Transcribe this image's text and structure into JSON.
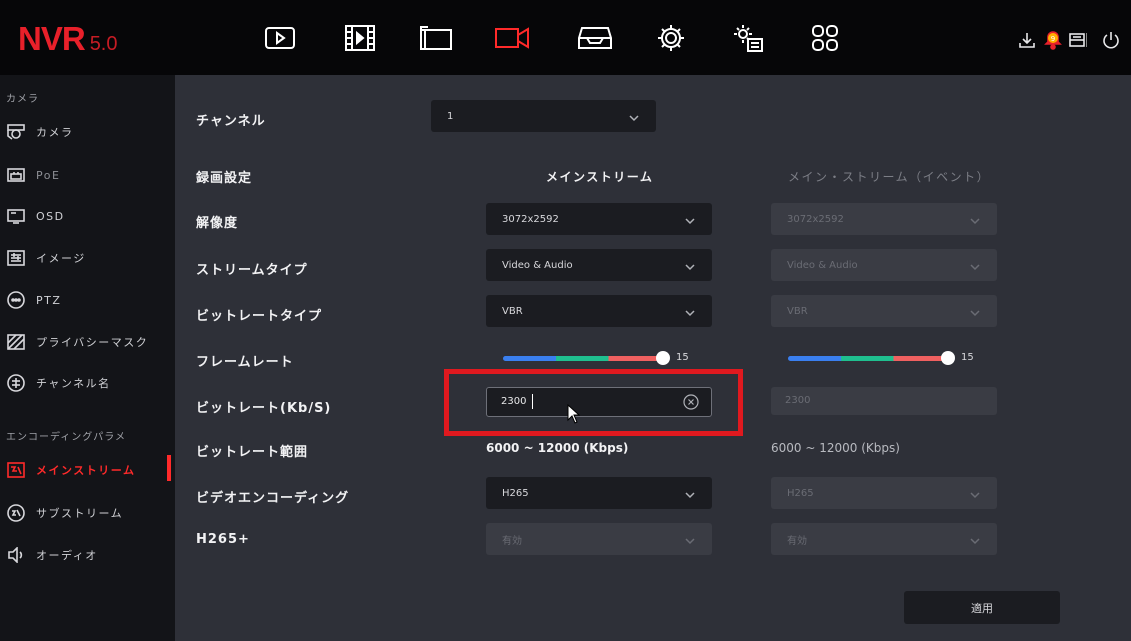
{
  "app": {
    "logo_main": "NVR",
    "logo_version": "5.0"
  },
  "topbar": {
    "nav_icons": [
      "live-view-icon",
      "playback-icon",
      "file-folder-icon",
      "camera-record-icon",
      "storage-icon",
      "settings-gear-icon",
      "system-settings-icon",
      "apps-grid-icon"
    ],
    "active_nav": "camera-record-icon",
    "notification_count": "9",
    "right_icons": [
      "download-icon",
      "alarm-bell-icon",
      "message-icon",
      "power-icon"
    ]
  },
  "sidebar": {
    "section_camera": "カメラ",
    "section_encoding": "エンコーディングパラメ",
    "items": [
      {
        "label": "カメラ",
        "icon": "camera-icon"
      },
      {
        "label": "PoE",
        "icon": "poe-icon"
      },
      {
        "label": "OSD",
        "icon": "osd-icon"
      },
      {
        "label": "イメージ",
        "icon": "image-icon"
      },
      {
        "label": "PTZ",
        "icon": "ptz-icon"
      },
      {
        "label": "プライバシーマスク",
        "icon": "privacy-mask-icon"
      },
      {
        "label": "チャンネル名",
        "icon": "channel-name-icon"
      },
      {
        "label": "メインストリーム",
        "icon": "mainstream-icon"
      },
      {
        "label": "サブストリーム",
        "icon": "substream-icon"
      },
      {
        "label": "オーディオ",
        "icon": "audio-icon"
      }
    ],
    "active_item": "メインストリーム"
  },
  "form": {
    "channel_label": "チャンネル",
    "channel_value": "1",
    "record_settings_label": "録画設定",
    "col_main": "メインストリーム",
    "col_event": "メイン・ストリーム（イベント）",
    "resolution_label": "解像度",
    "resolution_main": "3072x2592",
    "resolution_event": "3072x2592",
    "stream_type_label": "ストリームタイプ",
    "stream_type_main": "Video & Audio",
    "stream_type_event": "Video & Audio",
    "bitrate_type_label": "ビットレートタイプ",
    "bitrate_type_main": "VBR",
    "bitrate_type_event": "VBR",
    "frame_rate_label": "フレームレート",
    "frame_rate_main": 15,
    "frame_rate_event": 15,
    "frame_rate_max": 15,
    "bitrate_label": "ビットレート(Kb/S)",
    "bitrate_main": "2300",
    "bitrate_event": "2300",
    "bitrate_range_label": "ビットレート範囲",
    "bitrate_range_main": "6000 ~ 12000 (Kbps)",
    "bitrate_range_event": "6000 ~ 12000 (Kbps)",
    "video_encoding_label": "ビデオエンコーディング",
    "video_encoding_main": "H265",
    "video_encoding_event": "H265",
    "h265plus_label": "H265+",
    "h265plus_main": "有効",
    "h265plus_event": "有効",
    "apply_label": "適用"
  },
  "colors": {
    "accent_red": "#ff2a2a",
    "highlight_red": "#e0191f",
    "slider_blue": "#3a7ff0",
    "slider_green": "#1fbf8f",
    "slider_red": "#f06060"
  }
}
